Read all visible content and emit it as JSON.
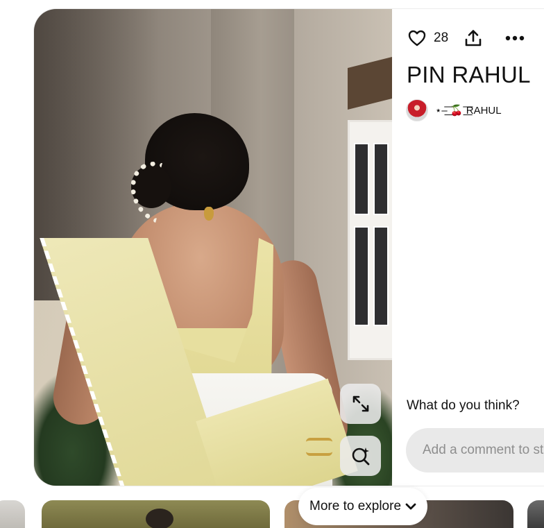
{
  "pin": {
    "like_count": "28",
    "title": "PIN RAHUL",
    "creator_name": "⋆–͟͟͞͞ 🍒 ͟͟͞͞RAHUL"
  },
  "comments": {
    "heading": "What do you think?",
    "placeholder": "Add a comment to start the conversation"
  },
  "explore": {
    "label": "More to explore"
  },
  "icons": {
    "like": "heart-icon",
    "share": "share-icon",
    "more": "ellipsis-icon",
    "expand": "expand-icon",
    "visual_search": "visual-search-icon",
    "explore_toggle": "chevron-down-icon"
  },
  "colors": {
    "background": "#ffffff",
    "text": "#111111",
    "comment_box": "#e9e9e9",
    "placeholder": "#8e8e8e",
    "overlay_button": "#ebebeb"
  }
}
